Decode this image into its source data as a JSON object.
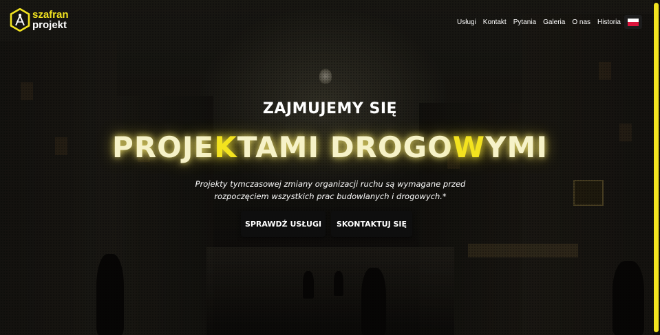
{
  "logo": {
    "line1": "szafran",
    "line2": "projekt",
    "brand_color": "#f2e320",
    "icon": "compass-hexagon-icon"
  },
  "nav": {
    "items": [
      "Usługi",
      "Kontakt",
      "Pytania",
      "Galeria",
      "O nas",
      "Historia"
    ],
    "language_flag": "poland-flag-icon"
  },
  "hero": {
    "kicker": "ZAJMUJEMY SIĘ",
    "headline_parts": [
      "PROJE",
      "K",
      "TAMI DROGO",
      "W",
      "YMI"
    ],
    "description_line1": "Projekty tymczasowej zmiany organizacji ruchu są wymagane przed",
    "description_line2": "rozpoczęciem wszystkich prac budowlanych i drogowych.*",
    "primary_button": "SPRAWDŹ USŁUGI",
    "secondary_button": "SKONTAKTUJ SIĘ",
    "accent_color": "#f3e31f"
  }
}
